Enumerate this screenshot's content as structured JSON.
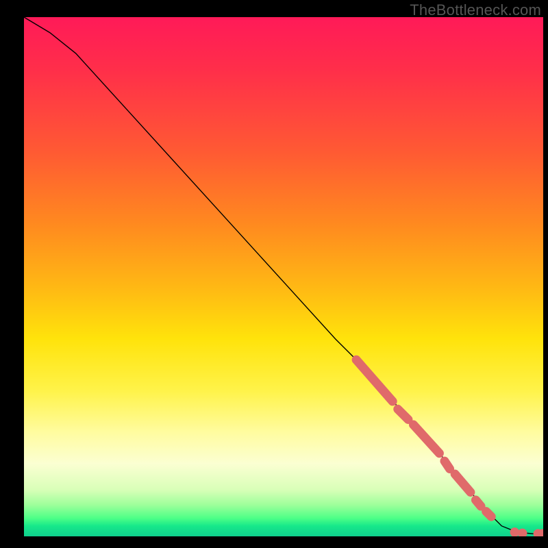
{
  "attribution": "TheBottleneck.com",
  "chart_data": {
    "type": "line",
    "title": "",
    "xlabel": "",
    "ylabel": "",
    "xlim": [
      0,
      100
    ],
    "ylim": [
      0,
      100
    ],
    "series": [
      {
        "name": "curve",
        "x": [
          0,
          5,
          10,
          20,
          30,
          40,
          50,
          60,
          65,
          70,
          75,
          80,
          85,
          88,
          90,
          92,
          95,
          98,
          100
        ],
        "y": [
          100,
          97,
          93,
          82,
          71,
          60,
          49,
          38,
          33,
          27,
          22,
          16,
          10,
          6,
          4,
          2,
          0.8,
          0.5,
          0.5
        ]
      }
    ],
    "marker_segments": [
      {
        "x0": 64,
        "y0": 34.0,
        "x1": 71,
        "y1": 26.0
      },
      {
        "x0": 72,
        "y0": 24.5,
        "x1": 74,
        "y1": 22.5
      },
      {
        "x0": 75,
        "y0": 21.5,
        "x1": 80,
        "y1": 16.0
      },
      {
        "x0": 81,
        "y0": 14.5,
        "x1": 82,
        "y1": 13.0
      },
      {
        "x0": 83,
        "y0": 12.0,
        "x1": 86,
        "y1": 8.5
      },
      {
        "x0": 87,
        "y0": 7.0,
        "x1": 88,
        "y1": 5.8
      },
      {
        "x0": 89,
        "y0": 4.8,
        "x1": 90,
        "y1": 3.8
      }
    ],
    "marker_dots": [
      {
        "x": 94.5,
        "y": 0.8
      },
      {
        "x": 96.0,
        "y": 0.6
      },
      {
        "x": 99.0,
        "y": 0.5
      },
      {
        "x": 99.8,
        "y": 0.5
      }
    ],
    "gradient_stops": [
      {
        "pos": 0.0,
        "color": "#ff1a58"
      },
      {
        "pos": 0.4,
        "color": "#ff8a1f"
      },
      {
        "pos": 0.62,
        "color": "#ffe30b"
      },
      {
        "pos": 0.86,
        "color": "#fbffd2"
      },
      {
        "pos": 0.96,
        "color": "#4dff87"
      },
      {
        "pos": 1.0,
        "color": "#0fd08d"
      }
    ],
    "marker_color": "#e06a6a",
    "line_color": "#000000"
  }
}
